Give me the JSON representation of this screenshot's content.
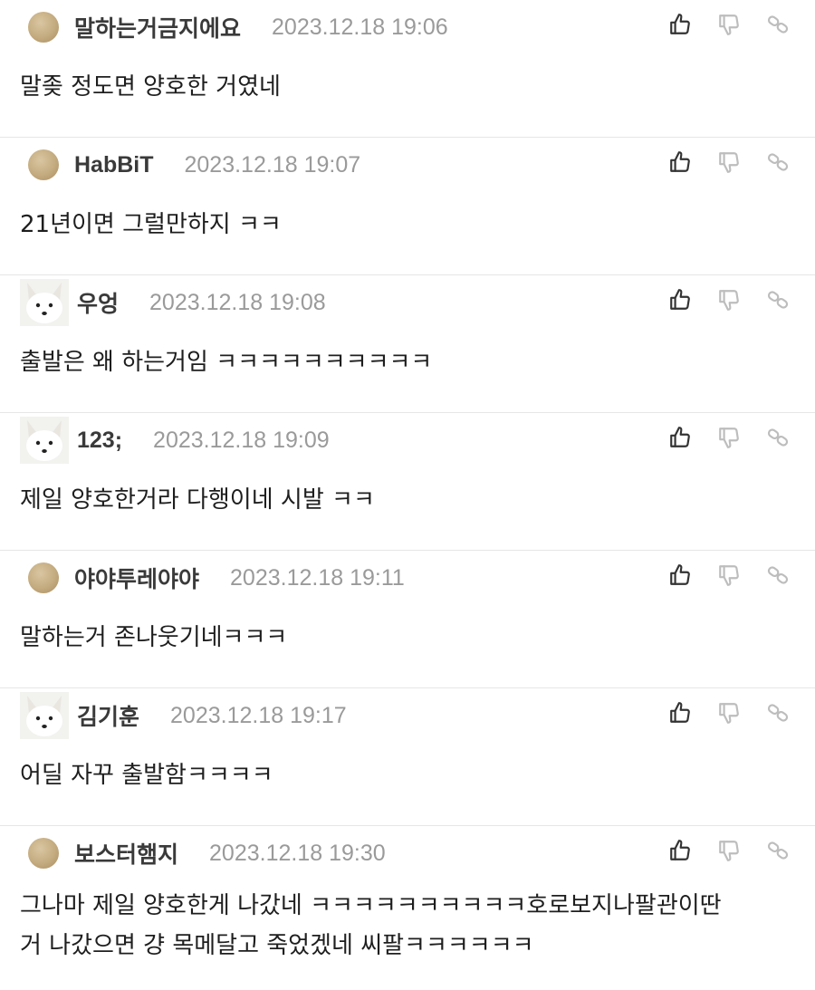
{
  "comments": [
    {
      "avatar": "round-brown",
      "nickname": "말하는거금지에요",
      "datetime": "2023.12.18 19:06",
      "text": "말좆 정도면 양호한 거였네"
    },
    {
      "avatar": "round-brown",
      "nickname": "HabBiT",
      "datetime": "2023.12.18 19:07",
      "text": "21년이면 그럴만하지 ㅋㅋ"
    },
    {
      "avatar": "arctic-fox",
      "nickname": "우엉",
      "datetime": "2023.12.18 19:08",
      "text": "출발은 왜 하는거임 ㅋㅋㅋㅋㅋㅋㅋㅋㅋㅋ"
    },
    {
      "avatar": "arctic-fox",
      "nickname": "123;",
      "datetime": "2023.12.18 19:09",
      "text": "제일 양호한거라 다행이네 시발 ㅋㅋ"
    },
    {
      "avatar": "round-brown",
      "nickname": "야야투레야야",
      "datetime": "2023.12.18 19:11",
      "text": "말하는거 존나웃기네ㅋㅋㅋ"
    },
    {
      "avatar": "arctic-fox",
      "nickname": "김기훈",
      "datetime": "2023.12.18 19:17",
      "text": "어딜 자꾸 출발함ㅋㅋㅋㅋ"
    },
    {
      "avatar": "round-brown",
      "nickname": "보스터햄지",
      "datetime": "2023.12.18 19:30",
      "text": "그나마 제일 양호한게 나갔네 ㅋㅋㅋㅋㅋㅋㅋㅋㅋㅋ호로보지나팔관이딴\n거 나갔으면 걍 목메달고 죽었겠네 씨팔ㅋㅋㅋㅋㅋㅋ"
    }
  ],
  "icons": {
    "like": "thumbs-up-icon",
    "dislike": "thumbs-down-icon",
    "share": "link-icon"
  },
  "colors": {
    "nickname": "#3a3a3a",
    "date": "#9a9a9a",
    "icon": "#333333",
    "icon_muted": "#bdbdbd",
    "divider": "#e6e6e6"
  }
}
